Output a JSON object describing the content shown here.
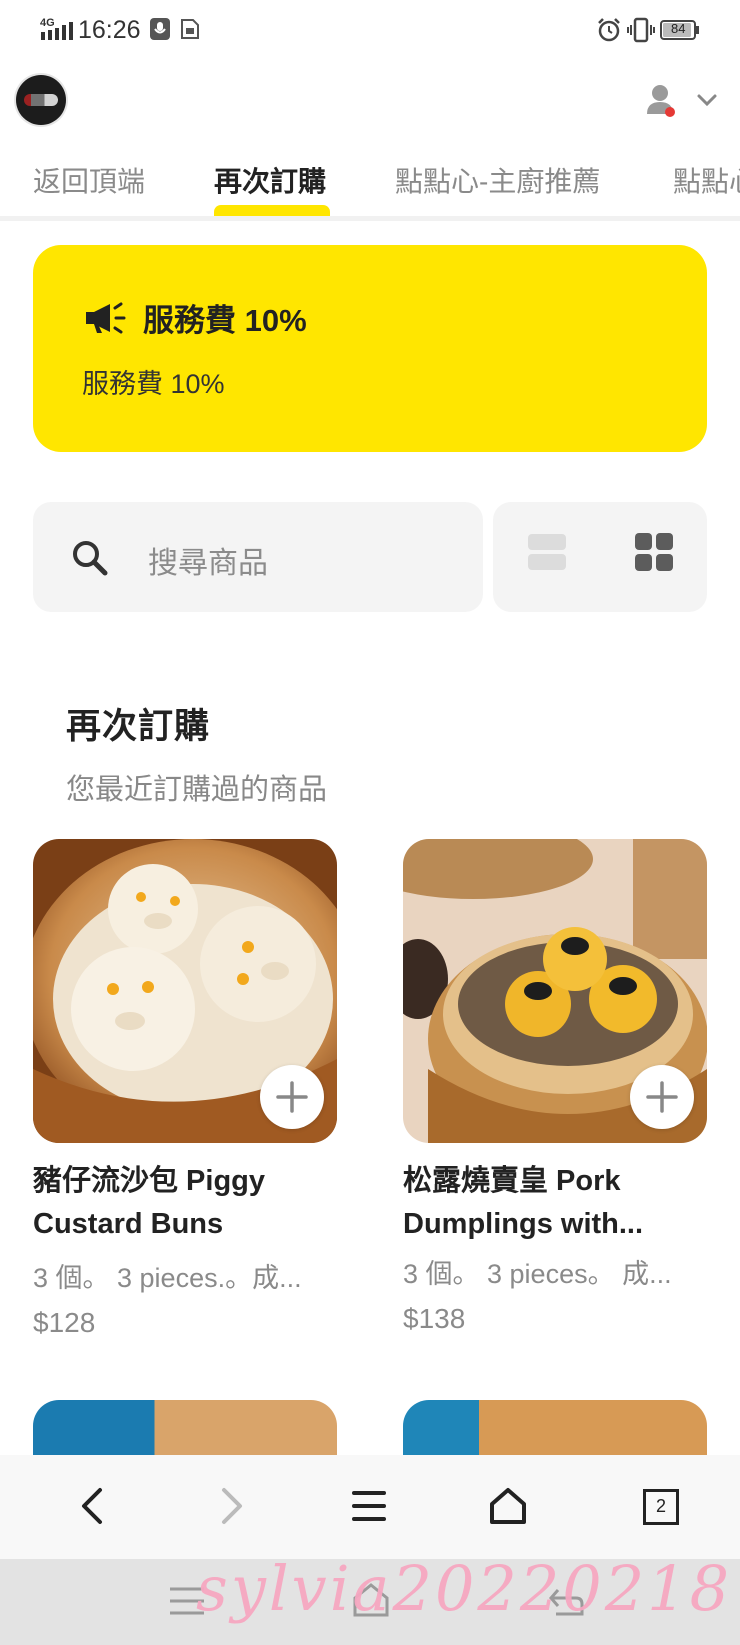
{
  "status_bar": {
    "network": "4G",
    "time": "16:26",
    "battery": "84"
  },
  "header": {
    "logo": "restaurant-logo",
    "account_icon": "person-icon",
    "dropdown_icon": "chevron-down-icon"
  },
  "tabs": [
    {
      "label": "返回頂端",
      "active": false
    },
    {
      "label": "再次訂購",
      "active": true
    },
    {
      "label": "點點心-主廚推薦",
      "active": false
    },
    {
      "label": "點點心",
      "active": false
    }
  ],
  "banner": {
    "icon": "megaphone-icon",
    "title": "服務費 10%",
    "subtitle": "服務費 10%"
  },
  "search": {
    "placeholder": "搜尋商品",
    "icon": "search-icon"
  },
  "view_toggle": {
    "list_icon": "list-view-icon",
    "grid_icon": "grid-view-icon",
    "selected": "grid"
  },
  "section": {
    "title": "再次訂購",
    "subtitle": "您最近訂購過的商品"
  },
  "products": [
    {
      "image": "piggy-custard-buns-photo",
      "name": "豬仔流沙包 Piggy Custard Buns",
      "description": "3 個。 3 pieces.。成...",
      "price": "$128"
    },
    {
      "image": "pork-dumplings-photo",
      "name": "松露燒賣皇 Pork Dumplings with...",
      "description": "3 個。 3 pieces。 成...",
      "price": "$138"
    }
  ],
  "browser_nav": {
    "back": "back-arrow-icon",
    "forward": "forward-arrow-icon",
    "menu": "menu-icon",
    "home": "home-icon",
    "tabs_count": "2"
  },
  "watermark": "sylvia20220218",
  "colors": {
    "accent_yellow": "#ffe600",
    "notification_red": "#e53935",
    "text_dark": "#222222",
    "text_muted": "#8a8a8a",
    "panel_gray": "#f4f4f4"
  }
}
